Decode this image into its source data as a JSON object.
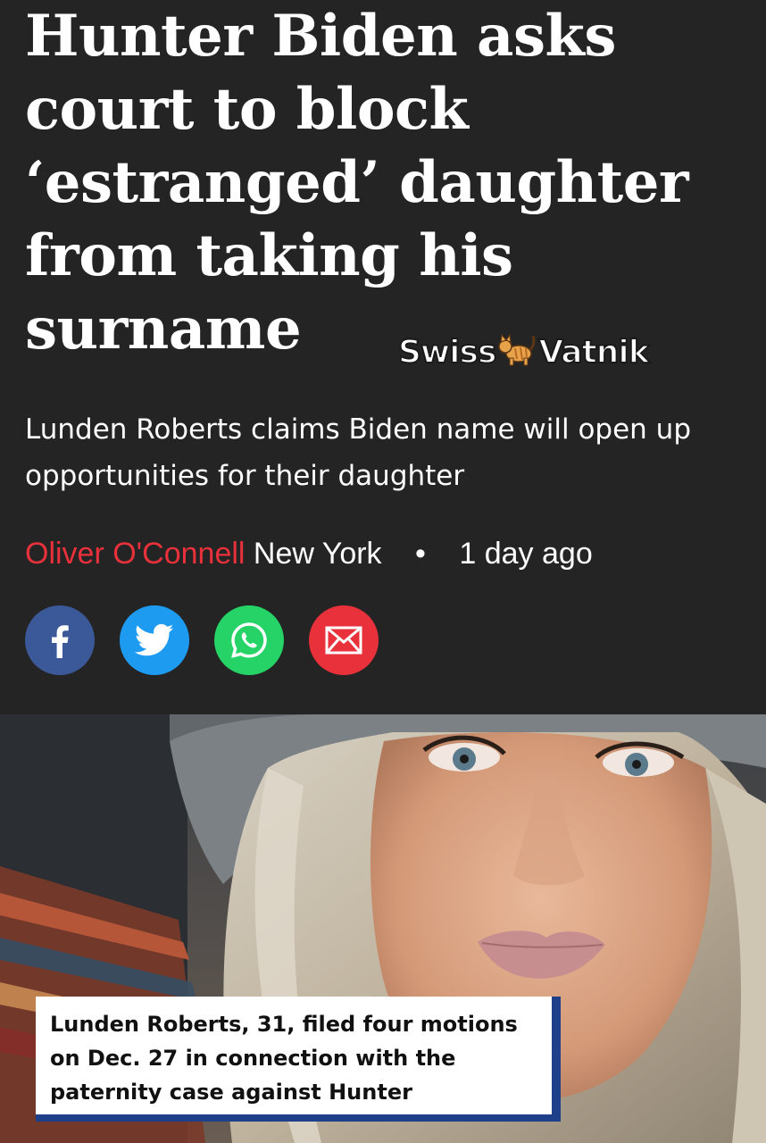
{
  "article": {
    "headline": "Hunter Biden asks court to block ‘estranged’ daughter from taking his surname",
    "subtitle": "Lunden Roberts claims Biden name will open up opportunities for their daughter",
    "byline": {
      "author": "Oliver O'Connell",
      "location": "New York",
      "separator": "•",
      "time": "1 day ago"
    }
  },
  "watermark": {
    "left": "Swiss",
    "right": "Vatnik",
    "icon": "cat-emoji"
  },
  "share": [
    {
      "name": "facebook",
      "icon": "facebook-icon",
      "color": "#3b5998"
    },
    {
      "name": "twitter",
      "icon": "twitter-icon",
      "color": "#1d9bf0"
    },
    {
      "name": "whatsapp",
      "icon": "whatsapp-icon",
      "color": "#25d366"
    },
    {
      "name": "email",
      "icon": "email-icon",
      "color": "#e8313a"
    }
  ],
  "photo": {
    "caption": "Lunden Roberts, 31, filed four motions on Dec. 27 in connection with the paternity case against Hunter"
  },
  "colors": {
    "background": "#242424",
    "author": "#e8313a",
    "caption_border": "#1e3f8a"
  }
}
